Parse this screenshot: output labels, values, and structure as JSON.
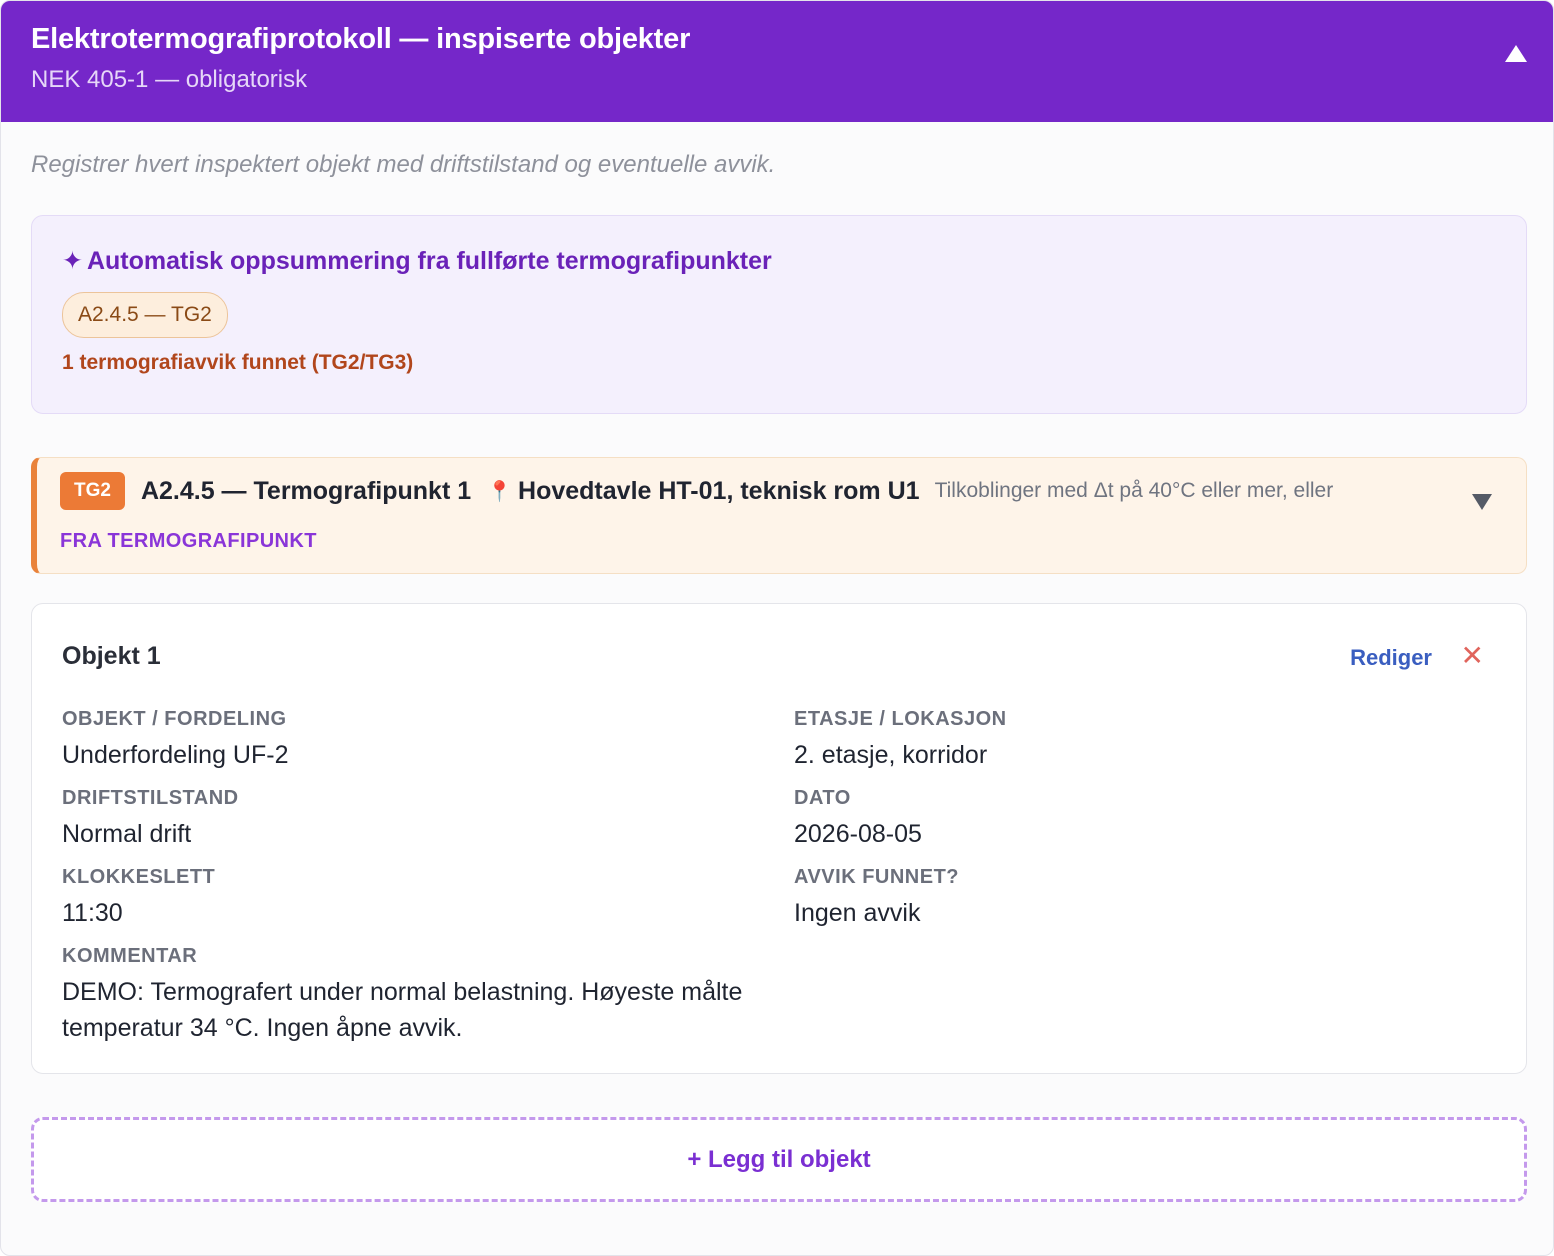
{
  "header": {
    "title": "Elektrotermografiprotokoll — inspiserte objekter",
    "subtitle": "NEK 405-1 — obligatorisk",
    "collapse_icon": "triangle-up-icon"
  },
  "intro": "Registrer hvert inspektert objekt med driftstilstand og eventuelle avvik.",
  "summary": {
    "icon": "✦",
    "title": "Automatisk oppsummering fra fullførte termografipunkter",
    "chips": [
      "A2.4.5 — TG2"
    ],
    "note": "1 termografiavvik funnet (TG2/TG3)",
    "colors": {
      "note": "#b1461c",
      "title": "#6a22b8"
    }
  },
  "point": {
    "badge": "TG2",
    "name": "A2.4.5 — Termografipunkt 1",
    "pin_icon": "📍",
    "location": "Hovedtavle HT-01, teknisk rom U1",
    "description": "Tilkoblinger med Δt på 40°C eller mer, eller",
    "source": "FRA TERMOGRAFIPUNKT",
    "expand_icon": "triangle-down-icon",
    "colors": {
      "badge": "#ec7a36",
      "background": "#fef4e9"
    }
  },
  "object": {
    "title": "Objekt 1",
    "edit_label": "Rediger",
    "remove_icon": "✕",
    "fields": {
      "objekt": {
        "label": "OBJEKT / FORDELING",
        "value": "Underfordeling UF-2"
      },
      "etasje": {
        "label": "ETASJE / LOKASJON",
        "value": "2. etasje, korridor"
      },
      "drift": {
        "label": "DRIFTSTILSTAND",
        "value": "Normal drift"
      },
      "dato": {
        "label": "DATO",
        "value": "2026-08-05"
      },
      "klokkeslett": {
        "label": "KLOKKESLETT",
        "value": "11:30"
      },
      "avvik": {
        "label": "AVVIK FUNNET?",
        "value": "Ingen avvik"
      },
      "kommentar": {
        "label": "KOMMENTAR",
        "value": "DEMO: Termografert under normal belastning. Høyeste målte temperatur 34 °C. Ingen åpne avvik."
      }
    }
  },
  "add_button": "+ Legg til objekt",
  "colors": {
    "accent": "#7527c9"
  }
}
